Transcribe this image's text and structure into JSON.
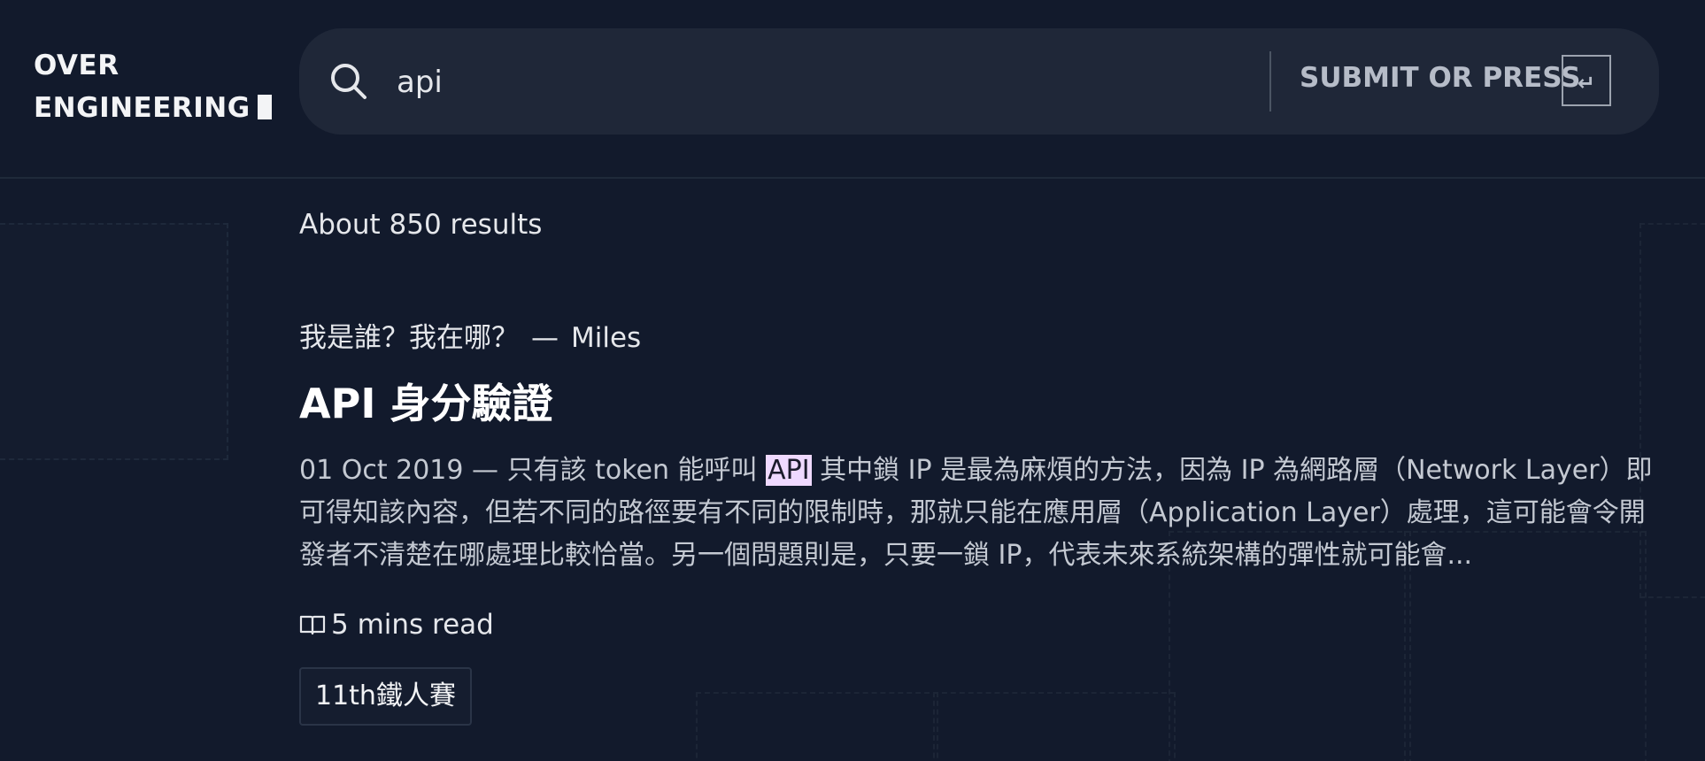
{
  "logo": {
    "line1": "OVER",
    "line2": "ENGINEERING"
  },
  "search": {
    "value": "api",
    "submit_label": "SUBMIT OR PRESS",
    "enter_key": "↵"
  },
  "results": {
    "count_text": "About 850 results",
    "items": [
      {
        "series": "我是誰？我在哪？",
        "separator": "—",
        "author": "Miles",
        "title": "API 身分驗證",
        "date": "01 Oct 2019",
        "dash": "—",
        "snippet_before": "只有該 token 能呼叫",
        "snippet_highlight": "API",
        "snippet_after": "其中鎖 IP 是最為麻煩的方法，因為 IP 為網路層（Network Layer）即可得知該內容，但若不同的路徑要有不同的限制時，那就只能在應用層（Application Layer）處理，這可能會令開發者不清楚在哪處理比較恰當。另一個問題則是，只要一鎖 IP，代表未來系統架構的彈性就可能會...",
        "read_time": "5 mins read",
        "tag": "11th鐵人賽"
      }
    ]
  },
  "colors": {
    "background": "#121a2c",
    "searchbar": "#1f2738",
    "highlight": "#efd9ff"
  }
}
